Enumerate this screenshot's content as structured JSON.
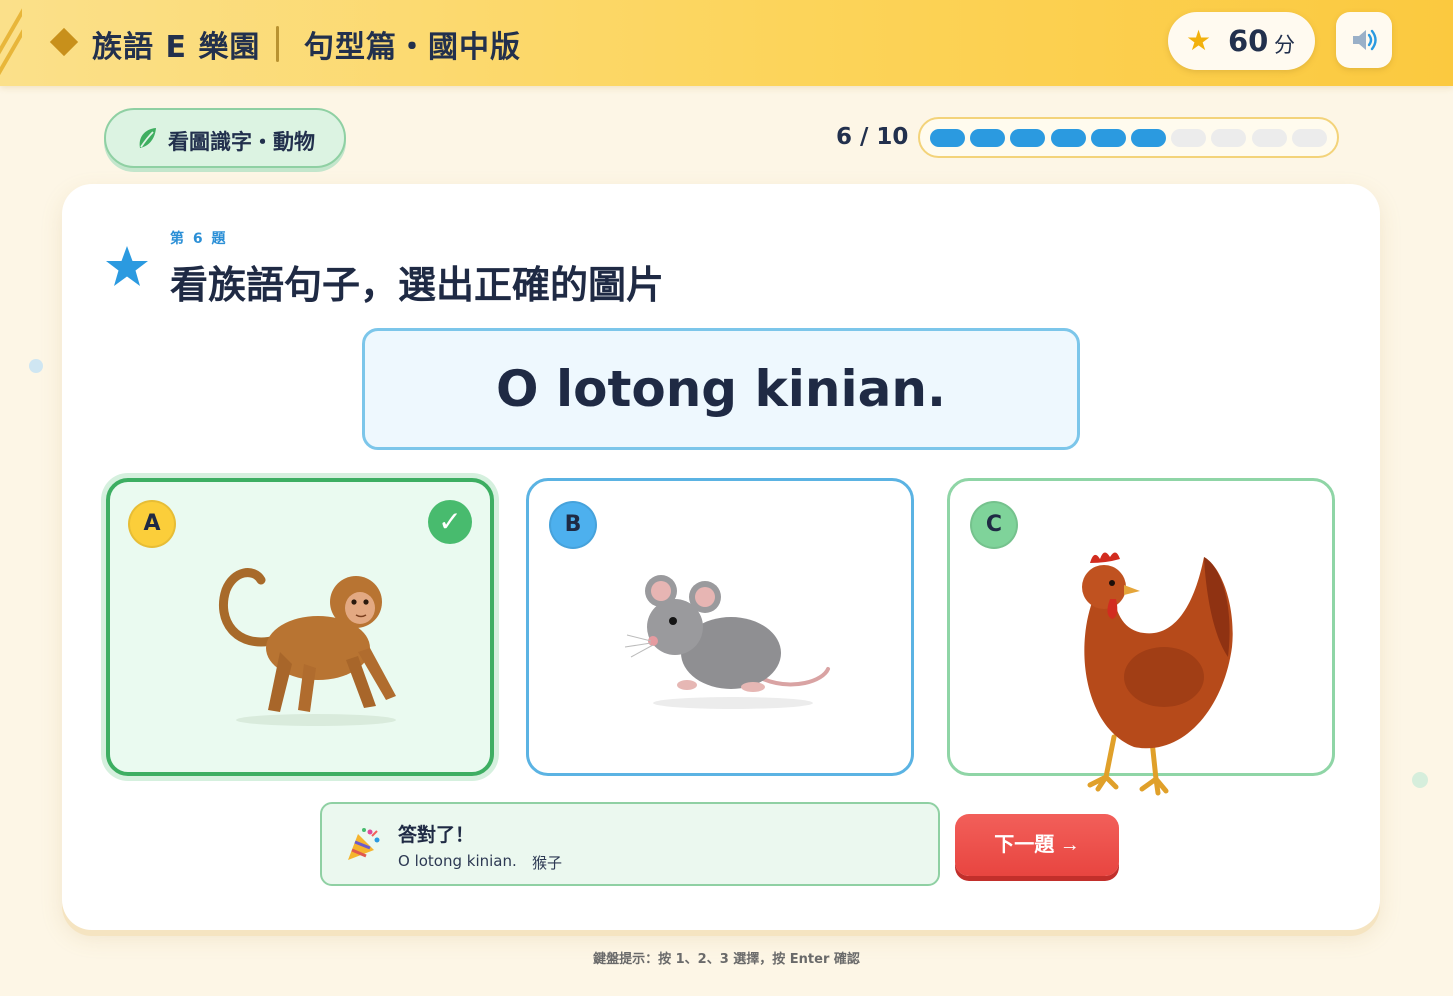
{
  "header": {
    "brand": "族語 E 樂園",
    "subtitle": "句型篇・國中版",
    "score_value": "60",
    "score_unit": "分",
    "sound_icon": "speaker-icon"
  },
  "category": {
    "icon": "leaf-icon",
    "label": "看圖識字・動物"
  },
  "progress": {
    "text": "6 / 10",
    "current": 6,
    "total": 10
  },
  "question": {
    "number_label": "第 6 題",
    "title": "看族語句子，選出正確的圖片",
    "sentence": "O lotong kinian."
  },
  "options": [
    {
      "letter": "A",
      "picture": "monkey",
      "selected": true,
      "correct": true
    },
    {
      "letter": "B",
      "picture": "mouse",
      "selected": false
    },
    {
      "letter": "C",
      "picture": "chicken",
      "selected": false
    }
  ],
  "feedback": {
    "icon": "party-popper-icon",
    "title": "答對了！",
    "sentence": "O lotong kinian.",
    "meaning": "猴子"
  },
  "next_button": {
    "label": "下一題 →"
  },
  "keyboard_hint": "鍵盤提示：按 1、2、3 選擇，按 Enter 確認",
  "colors": {
    "header": "#fcd45a",
    "correct": "#48bb6e",
    "accent_blue": "#2b9ae0",
    "next_button": "#e84540"
  }
}
